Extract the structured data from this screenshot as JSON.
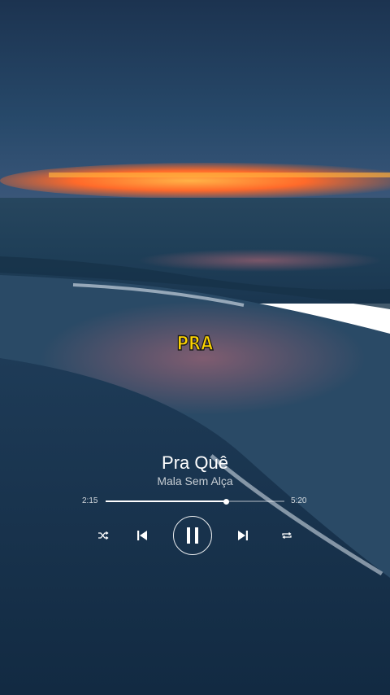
{
  "lyric": {
    "text": "PRA"
  },
  "song": {
    "title": "Pra Quê",
    "artist": "Mala Sem Alça"
  },
  "progress": {
    "current": "2:15",
    "total": "5:20",
    "fraction": 0.675
  },
  "controls": {
    "shuffle_icon": "shuffle-icon",
    "previous_icon": "skip-previous-icon",
    "play_pause_icon": "pause-icon",
    "next_icon": "skip-next-icon",
    "repeat_icon": "repeat-icon"
  },
  "colors": {
    "lyric": "#ffd400",
    "text": "#ffffff",
    "sky": "#1e3550",
    "sunset": "#ff7a2a"
  }
}
